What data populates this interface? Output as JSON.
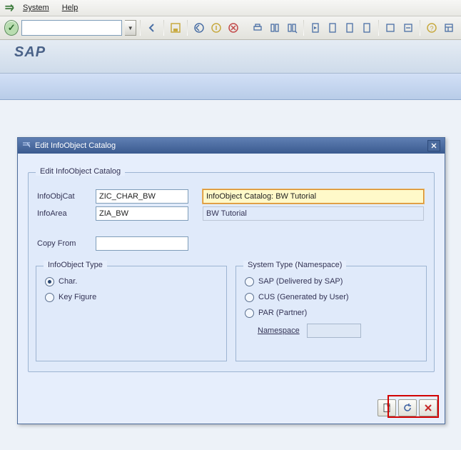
{
  "menubar": {
    "system": "System",
    "help": "Help"
  },
  "title_band": "SAP",
  "dialog": {
    "title": "Edit InfoObject Catalog",
    "group_label": "Edit InfoObject Catalog",
    "fields": {
      "infoobjcat_label": "InfoObjCat",
      "infoobjcat_value": "ZIC_CHAR_BW",
      "infoobjcat_desc": "InfoObject Catalog: BW Tutorial",
      "infoarea_label": "InfoArea",
      "infoarea_value": "ZIA_BW",
      "infoarea_desc": "BW Tutorial",
      "copyfrom_label": "Copy From",
      "copyfrom_value": ""
    },
    "infoobject_type": {
      "label": "InfoObject Type",
      "char": "Char.",
      "keyfig": "Key Figure",
      "selected": "char"
    },
    "system_type": {
      "label": "System Type (Namespace)",
      "sap": "SAP (Delivered by SAP)",
      "cus": "CUS (Generated by User)",
      "par": "PAR (Partner)",
      "namespace_label": "Namespace",
      "namespace_value": ""
    }
  }
}
